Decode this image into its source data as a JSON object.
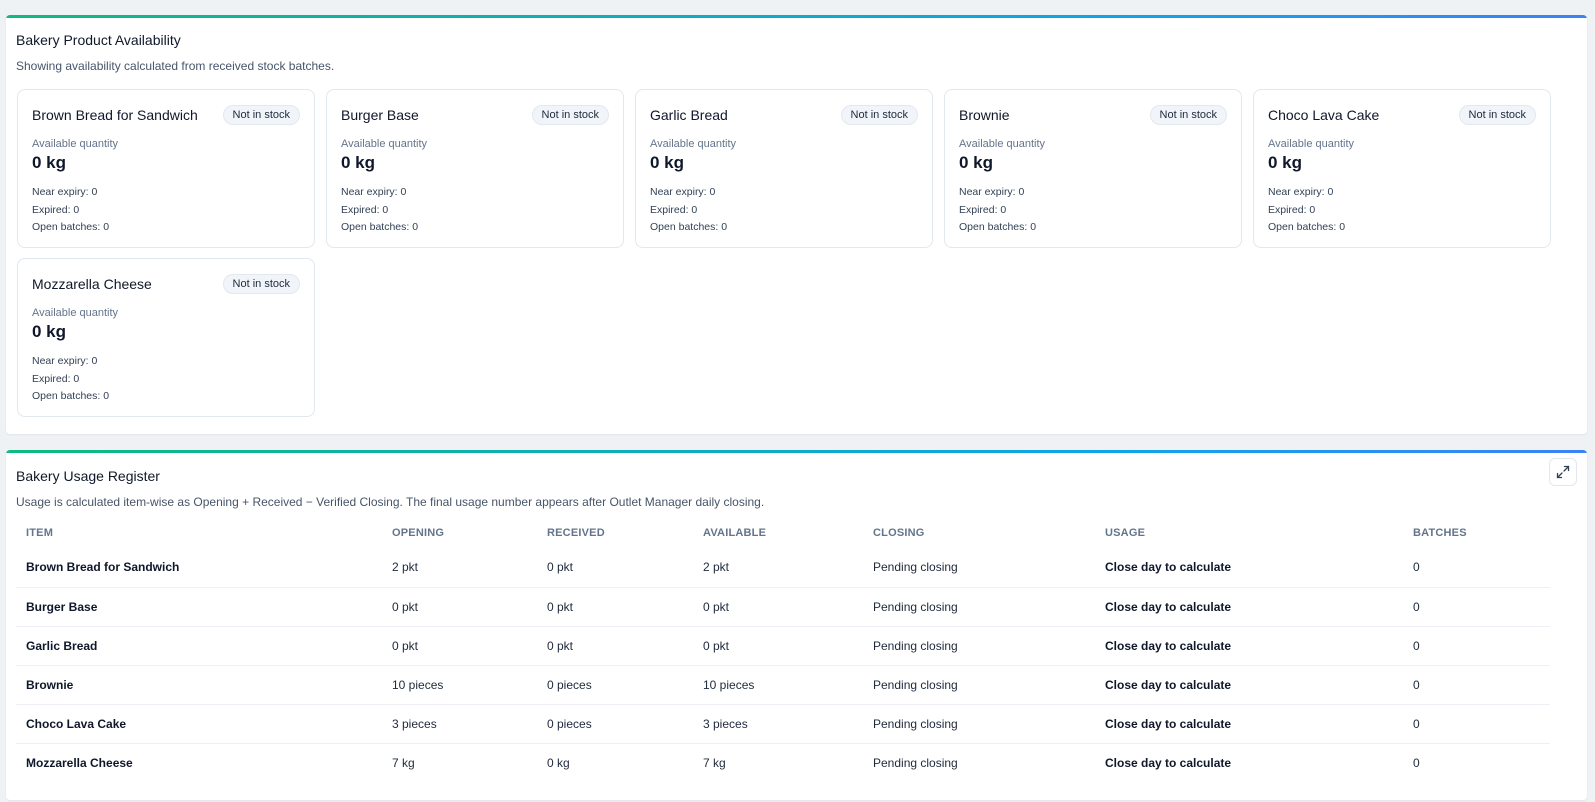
{
  "availability": {
    "title": "Bakery Product Availability",
    "subtitle": "Showing availability calculated from received stock batches.",
    "accent_colors": [
      "#10b981",
      "#3b82f6"
    ],
    "cards": [
      {
        "name": "Brown Bread for Sandwich",
        "status": "Not in stock",
        "qty_label": "Available quantity",
        "qty": "0 kg",
        "near_expiry": "Near expiry: 0",
        "expired": "Expired: 0",
        "open_batches": "Open batches: 0"
      },
      {
        "name": "Burger Base",
        "status": "Not in stock",
        "qty_label": "Available quantity",
        "qty": "0 kg",
        "near_expiry": "Near expiry: 0",
        "expired": "Expired: 0",
        "open_batches": "Open batches: 0"
      },
      {
        "name": "Garlic Bread",
        "status": "Not in stock",
        "qty_label": "Available quantity",
        "qty": "0 kg",
        "near_expiry": "Near expiry: 0",
        "expired": "Expired: 0",
        "open_batches": "Open batches: 0"
      },
      {
        "name": "Brownie",
        "status": "Not in stock",
        "qty_label": "Available quantity",
        "qty": "0 kg",
        "near_expiry": "Near expiry: 0",
        "expired": "Expired: 0",
        "open_batches": "Open batches: 0"
      },
      {
        "name": "Choco Lava Cake",
        "status": "Not in stock",
        "qty_label": "Available quantity",
        "qty": "0 kg",
        "near_expiry": "Near expiry: 0",
        "expired": "Expired: 0",
        "open_batches": "Open batches: 0"
      },
      {
        "name": "Mozzarella Cheese",
        "status": "Not in stock",
        "qty_label": "Available quantity",
        "qty": "0 kg",
        "near_expiry": "Near expiry: 0",
        "expired": "Expired: 0",
        "open_batches": "Open batches: 0"
      }
    ]
  },
  "usage": {
    "title": "Bakery Usage Register",
    "subtitle": "Usage is calculated item-wise as Opening + Received − Verified Closing. The final usage number appears after Outlet Manager daily closing.",
    "expand_icon": "expand-icon",
    "columns": [
      "ITEM",
      "OPENING",
      "RECEIVED",
      "AVAILABLE",
      "CLOSING",
      "USAGE",
      "BATCHES"
    ],
    "rows": [
      [
        "Brown Bread for Sandwich",
        "2 pkt",
        "0 pkt",
        "2 pkt",
        "Pending closing",
        "Close day to calculate",
        "0"
      ],
      [
        "Burger Base",
        "0 pkt",
        "0 pkt",
        "0 pkt",
        "Pending closing",
        "Close day to calculate",
        "0"
      ],
      [
        "Garlic Bread",
        "0 pkt",
        "0 pkt",
        "0 pkt",
        "Pending closing",
        "Close day to calculate",
        "0"
      ],
      [
        "Brownie",
        "10 pieces",
        "0 pieces",
        "10 pieces",
        "Pending closing",
        "Close day to calculate",
        "0"
      ],
      [
        "Choco Lava Cake",
        "3 pieces",
        "0 pieces",
        "3 pieces",
        "Pending closing",
        "Close day to calculate",
        "0"
      ],
      [
        "Mozzarella Cheese",
        "7 kg",
        "0 kg",
        "7 kg",
        "Pending closing",
        "Close day to calculate",
        "0"
      ]
    ]
  }
}
